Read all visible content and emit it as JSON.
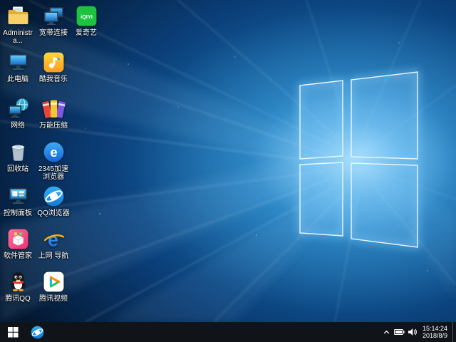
{
  "colors": {
    "taskbar_bg": "#101418",
    "wallpaper_deep_navy": "#041832",
    "wallpaper_bright_azure": "#2d96d8",
    "logo_glow": "#bfe6ff"
  },
  "desktop": {
    "icons": [
      {
        "id": "administrator",
        "label": "Administra..."
      },
      {
        "id": "broadband",
        "label": "宽带连接"
      },
      {
        "id": "iqiyi",
        "label": "爱奇艺"
      },
      {
        "id": "this-pc",
        "label": "此电脑"
      },
      {
        "id": "kuwo-music",
        "label": "酷我音乐"
      },
      {
        "id": "network",
        "label": "网络"
      },
      {
        "id": "compressor",
        "label": "万能压缩"
      },
      {
        "id": "recycle-bin",
        "label": "回收站"
      },
      {
        "id": "2345-browser",
        "label": "2345加速浏览器"
      },
      {
        "id": "control-panel",
        "label": "控制面板"
      },
      {
        "id": "qq-browser",
        "label": "QQ浏览器"
      },
      {
        "id": "software-manager",
        "label": "软件管家"
      },
      {
        "id": "web-nav",
        "label": "上网 导航"
      },
      {
        "id": "tencent-qq",
        "label": "腾讯QQ"
      },
      {
        "id": "tencent-video",
        "label": "腾讯视频"
      }
    ],
    "iqiyi_logo_text": "iQIYI"
  },
  "taskbar": {
    "clock": {
      "time": "15:14:24",
      "date": "2018/8/9"
    }
  }
}
